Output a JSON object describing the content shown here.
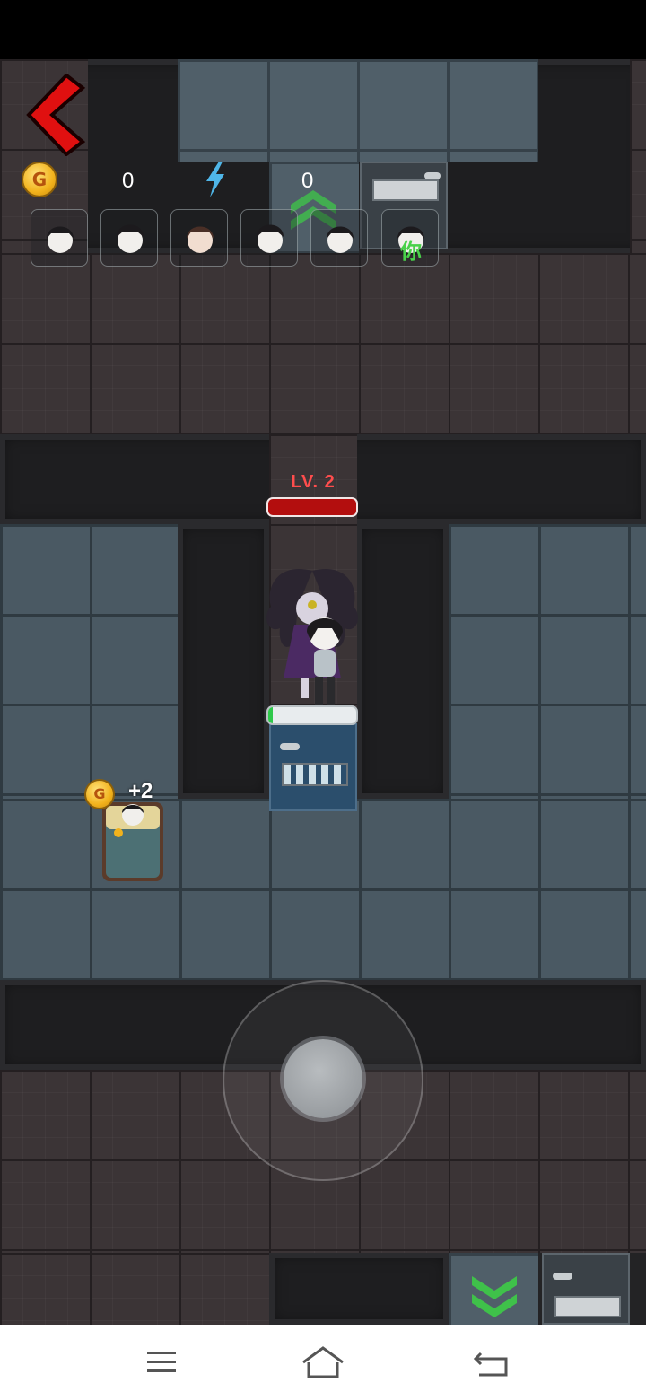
{
  "hud": {
    "coin_symbol": "G",
    "coin_count": "0",
    "energy_icon": "lightning-bolt-icon",
    "energy_count": "0",
    "back_icon": "back-chevron-icon"
  },
  "players": [
    {
      "icon": "player-avatar-1"
    },
    {
      "icon": "player-avatar-2"
    },
    {
      "icon": "player-avatar-3"
    },
    {
      "icon": "player-avatar-4"
    },
    {
      "icon": "player-avatar-5"
    },
    {
      "icon": "player-avatar-self",
      "label": "你"
    }
  ],
  "enemy": {
    "level_label": "LV. 2",
    "health_fraction": 1.0
  },
  "door": {
    "health_fraction": 0.05
  },
  "bed": {
    "coin_symbol": "G",
    "reward_label": "+2"
  },
  "colors": {
    "back_button": "#e01010",
    "upgrade_arrow": "#3fc14a",
    "enemy_health": "#b30e0e",
    "door_health": "#2ec84a"
  },
  "nav": {
    "menu_icon": "menu-icon",
    "home_icon": "home-icon",
    "back_icon": "back-icon"
  }
}
